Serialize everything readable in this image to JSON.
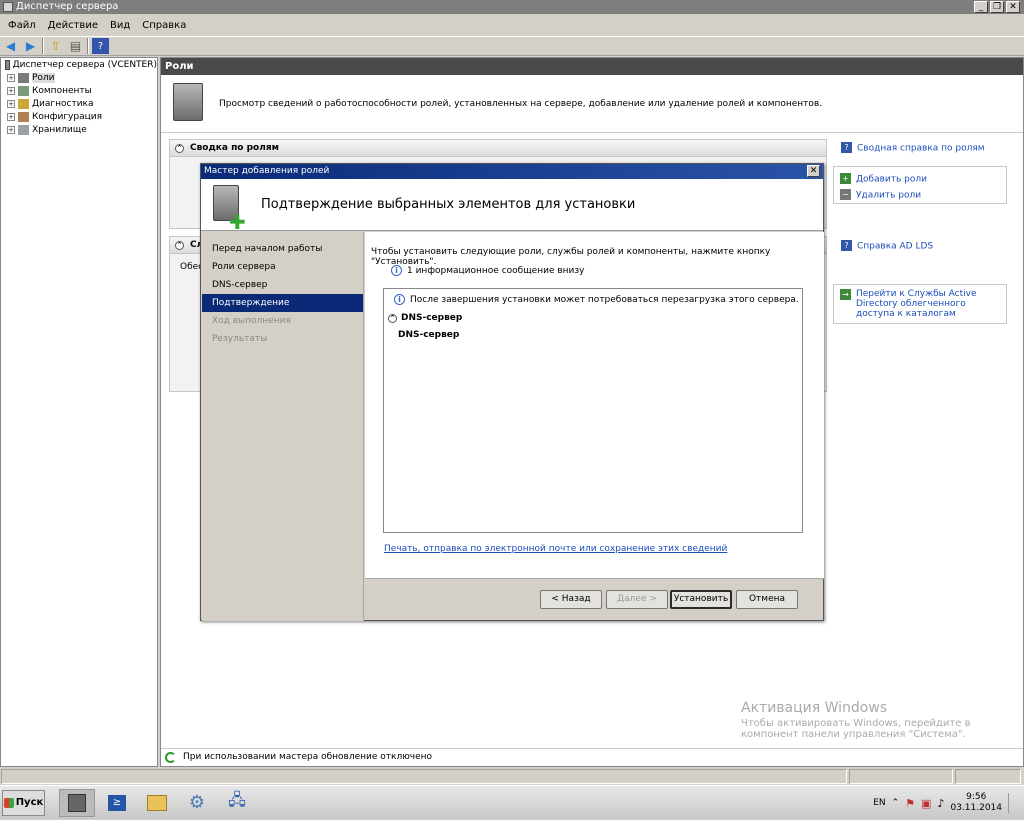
{
  "window": {
    "title": "Диспетчер сервера"
  },
  "menu": [
    "Файл",
    "Действие",
    "Вид",
    "Справка"
  ],
  "tree": {
    "root": "Диспетчер сервера (VCENTER)",
    "items": [
      "Роли",
      "Компоненты",
      "Диагностика",
      "Конфигурация",
      "Хранилище"
    ]
  },
  "main": {
    "header": "Роли",
    "description": "Просмотр сведений о работоспособности ролей, установленных на сервере, добавление или удаление ролей и компонентов.",
    "summary_title": "Сводка по ролям",
    "summary_help": "Сводная справка по ролям",
    "add_roles": "Добавить роли",
    "remove_roles": "Удалить роли",
    "section2_title_partial": "Сл",
    "section2_text_partial": "Обес",
    "section2_help": "Справка AD LDS",
    "goto_link": "Перейти к Службы Active Directory облегченного доступа к каталогам",
    "status": "При использовании мастера обновление отключено"
  },
  "dialog": {
    "title": "Мастер добавления ролей",
    "heading": "Подтверждение выбранных элементов для установки",
    "steps": [
      "Перед началом работы",
      "Роли сервера",
      "DNS-сервер",
      "Подтверждение",
      "Ход выполнения",
      "Результаты"
    ],
    "instruction": "Чтобы установить следующие роли, службы ролей и компоненты, нажмите кнопку \"Установить\".",
    "info_count": "1 информационное сообщение внизу",
    "reboot_msg": "После завершения установки может потребоваться перезагрузка этого сервера.",
    "group_title": "DNS-сервер",
    "group_item": "DNS-сервер",
    "print_link": "Печать, отправка по электронной почте или сохранение этих сведений",
    "buttons": {
      "back": "< Назад",
      "next": "Далее >",
      "install": "Установить",
      "cancel": "Отмена"
    }
  },
  "watermark": {
    "line1": "Активация Windows",
    "line2": "Чтобы активировать Windows, перейдите в",
    "line3": "компонент панели управления \"Система\"."
  },
  "taskbar": {
    "start": "Пуск",
    "lang": "EN",
    "time": "9:56",
    "date": "03.11.2014"
  }
}
